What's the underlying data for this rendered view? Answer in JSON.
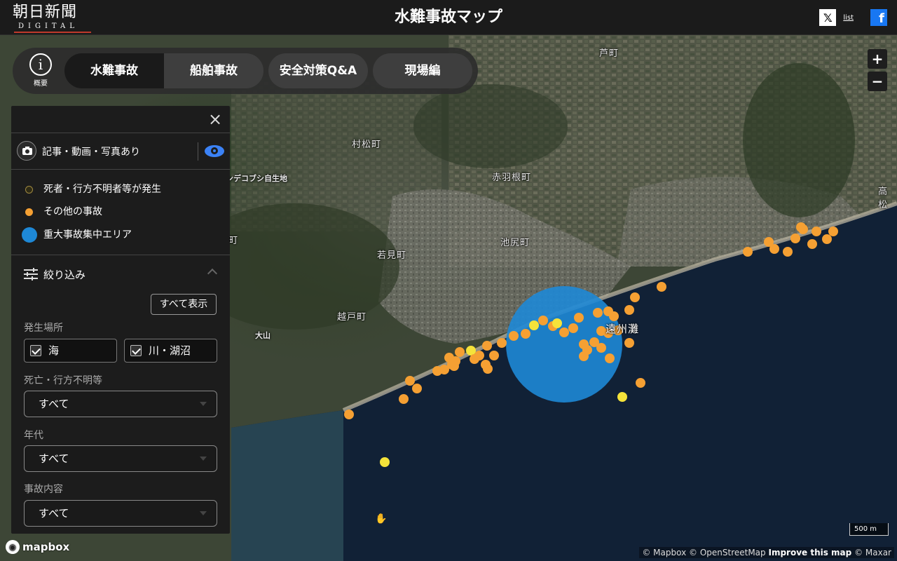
{
  "header": {
    "logo_main": "朝日新聞",
    "logo_sub": "DIGITAL",
    "title": "水難事故マップ",
    "share_x": "𝕏",
    "share_list": "list",
    "share_fb": "f"
  },
  "tabs": {
    "info_label": "概要",
    "items": [
      {
        "label": "水難事故"
      },
      {
        "label": "船舶事故"
      },
      {
        "label": "安全対策Q&A"
      },
      {
        "label": "現場編"
      }
    ]
  },
  "panel": {
    "close": "×",
    "media_label": "記事・動画・写真あり",
    "legend": [
      {
        "label": "死者・行方不明者等が発生",
        "color": "#2e2a15"
      },
      {
        "label": "その他の事故",
        "color": "#f5a033"
      },
      {
        "label": "重大事故集中エリア",
        "color": "#1e88d6"
      }
    ],
    "filter_label": "絞り込み",
    "show_all": "すべて表示",
    "location_label": "発生場所",
    "location_options": [
      "海",
      "川・湖沼"
    ],
    "death_label": "死亡・行方不明等",
    "death_value": "すべて",
    "era_label": "年代",
    "era_value": "すべて",
    "type_label": "事故内容",
    "type_value": "すべて"
  },
  "map": {
    "places": [
      "芦町",
      "村松町",
      "ンデコブシ自生地",
      "赤羽根町",
      "高松",
      "池尻町",
      "若見町",
      "町",
      "越戸町",
      "大山",
      "遠州灘"
    ],
    "zoom_in": "+",
    "zoom_out": "−",
    "scale": "500 m",
    "attribution_prefix": "© Mapbox © OpenStreetMap",
    "attribution_link": "Improve this map",
    "attribution_suffix": "© Maxar",
    "mapbox_logo": "mapbox",
    "colors": {
      "other": "#f5a033",
      "fatal": "#f5e33a",
      "cluster": "#1e88d6"
    }
  }
}
